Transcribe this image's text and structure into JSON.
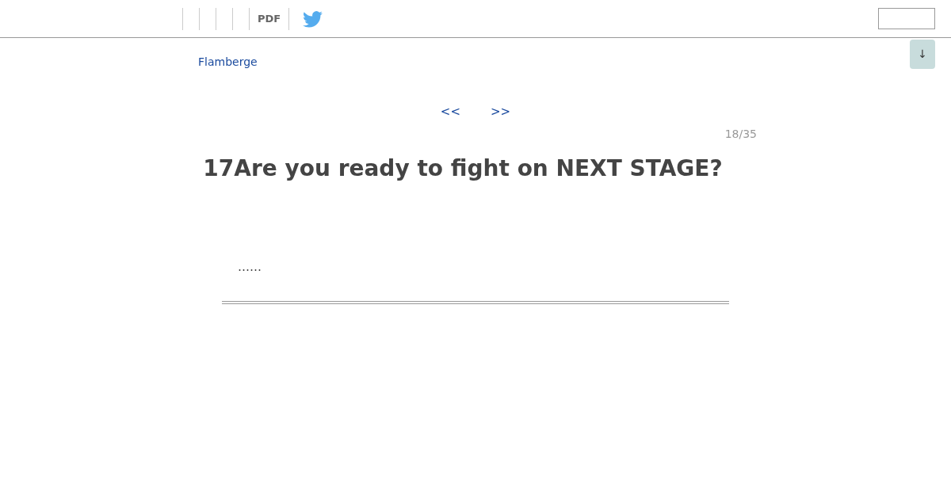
{
  "toolbar": {
    "pdf_label": "PDF"
  },
  "scroll_button": {
    "label": "↓"
  },
  "breadcrumb": "Flamberge",
  "pager": {
    "prev": "<<",
    "next": ">>",
    "count": "18/35"
  },
  "heading": "17Are you ready to fight on NEXT STAGE?",
  "body": "……"
}
